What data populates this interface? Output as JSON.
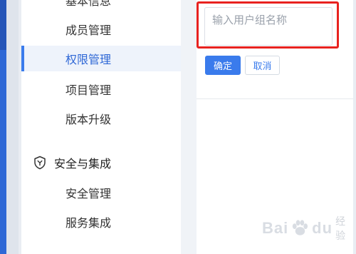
{
  "sidebar": {
    "items": [
      {
        "label": "基本信息"
      },
      {
        "label": "成员管理"
      },
      {
        "label": "权限管理"
      },
      {
        "label": "项目管理"
      },
      {
        "label": "版本升级"
      }
    ],
    "group": {
      "title": "安全与集成",
      "icon": "shield-icon",
      "items": [
        {
          "label": "安全管理"
        },
        {
          "label": "服务集成"
        }
      ]
    },
    "active_item": "权限管理",
    "accent": "#3a7bec"
  },
  "form": {
    "name_placeholder": "输入用户组名称",
    "confirm_label": "确定",
    "cancel_label": "取消",
    "highlight_color": "#e8221f"
  },
  "watermark": {
    "text": "Bai",
    "text_after": "du",
    "sub": "经验"
  }
}
